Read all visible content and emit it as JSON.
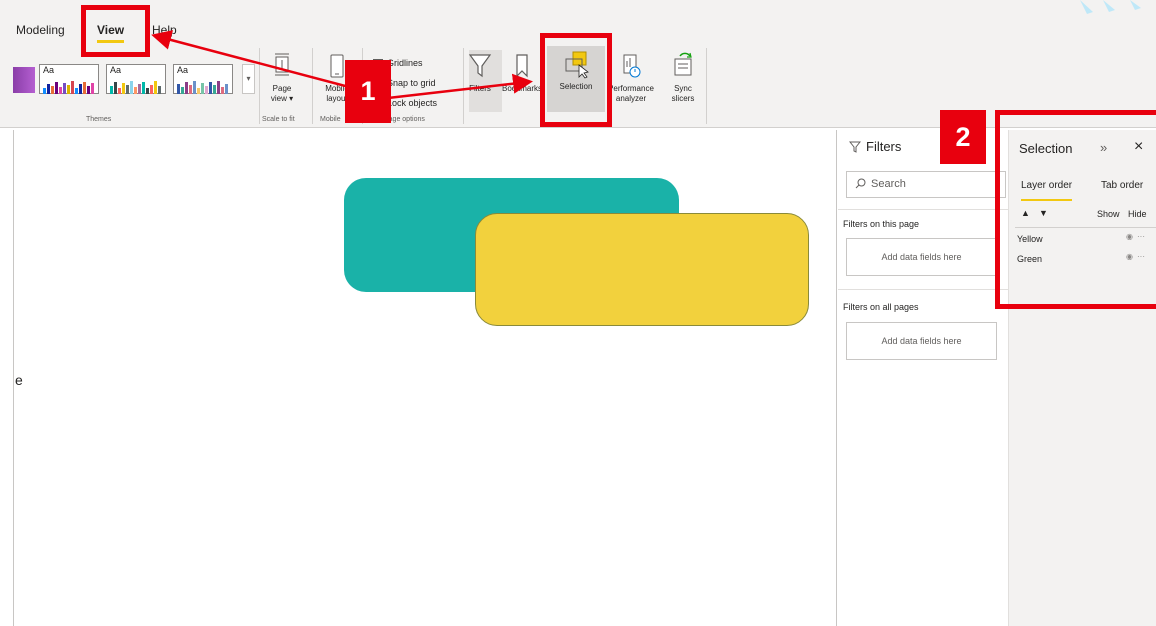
{
  "ribbon": {
    "tabs": [
      {
        "label": "Modeling"
      },
      {
        "label": "View"
      },
      {
        "label": "Help"
      }
    ],
    "groups": {
      "themes": "Themes",
      "scale_to_fit": "Scale to fit",
      "mobile": "Mobile",
      "page_options": "Page options"
    },
    "themes": {
      "swatch_text": "Aa"
    },
    "buttons": {
      "page_view": "Page view",
      "mobile_layout": "Mobile layout",
      "filters": "Filters",
      "bookmarks": "Bookmarks",
      "selection": "Selection",
      "performance_analyzer": "Performance analyzer",
      "sync_slicers": "Sync slicers"
    },
    "page_options": {
      "gridlines": "Gridlines",
      "snap_to_grid": "Snap to grid",
      "lock_objects": "Lock objects"
    }
  },
  "canvas": {
    "edge_char": "e",
    "shapes": [
      {
        "name": "Green",
        "color": "#1ab2a8"
      },
      {
        "name": "Yellow",
        "color": "#f2d13d"
      }
    ]
  },
  "filters_pane": {
    "title": "Filters",
    "search_placeholder": "Search",
    "sections": [
      {
        "label": "Filters on this page",
        "dropzone": "Add data fields here"
      },
      {
        "label": "Filters on all pages",
        "dropzone": "Add data fields here"
      }
    ]
  },
  "selection_pane": {
    "title": "Selection",
    "tabs": [
      "Layer order",
      "Tab order"
    ],
    "columns": {
      "show": "Show",
      "hide": "Hide"
    },
    "layers": [
      {
        "name": "Yellow"
      },
      {
        "name": "Green"
      }
    ]
  },
  "annotations": {
    "badge_1": "1",
    "badge_2": "2",
    "color": "#e8000e"
  }
}
